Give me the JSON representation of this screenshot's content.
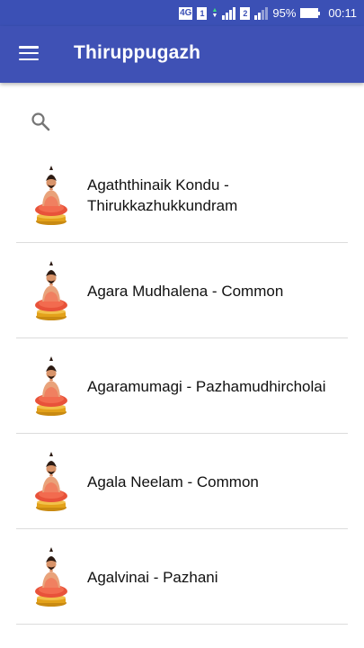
{
  "status_bar": {
    "network": "4G",
    "sim1": "1",
    "sim2": "2",
    "battery": "95%",
    "time": "00:11"
  },
  "app_bar": {
    "title": "Thiruppugazh",
    "menu_icon": "hamburger-menu-icon"
  },
  "search": {
    "icon": "search-icon"
  },
  "songs": [
    {
      "title": "Agaththinaik Kondu - Thirukkazhukkundram"
    },
    {
      "title": "Agara Mudhalena - Common"
    },
    {
      "title": "Agaramumagi - Pazhamudhircholai"
    },
    {
      "title": "Agala Neelam - Common"
    },
    {
      "title": "Agalvinai - Pazhani"
    }
  ],
  "colors": {
    "primary": "#3f51b5",
    "status_bar": "#3b50b5"
  }
}
